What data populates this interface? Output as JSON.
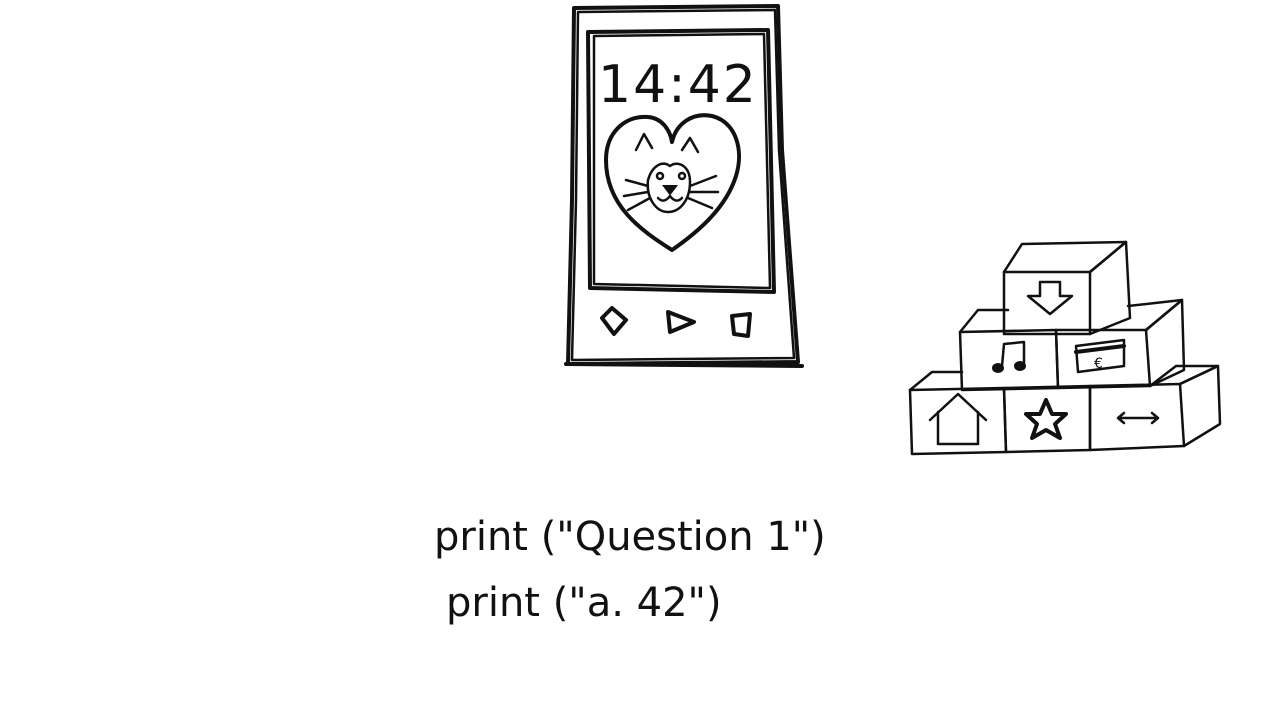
{
  "phone": {
    "clock": "14:42",
    "wallpaper_icon": "cat-in-heart",
    "nav_icons": [
      "back-diamond-icon",
      "play-icon",
      "square-icon"
    ]
  },
  "blocks": {
    "icons": [
      "download-arrow-icon",
      "music-note-icon",
      "credit-card-euro-icon",
      "home-icon",
      "star-icon",
      "double-arrow-icon"
    ],
    "card_symbol": "€"
  },
  "code": {
    "line1": "print (\"Question 1\")",
    "line2": "print (\"a.  42\")"
  }
}
